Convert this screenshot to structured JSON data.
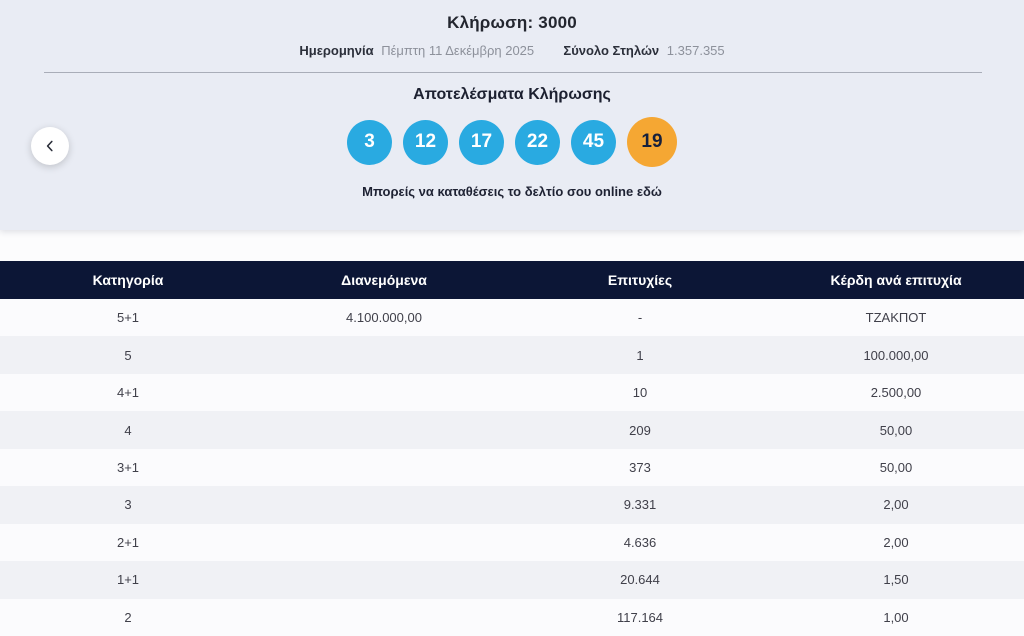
{
  "draw": {
    "title": "Κλήρωση: 3000",
    "date_label": "Ημερομηνία",
    "date_value": "Πέμπτη 11 Δεκέμβρη 2025",
    "columns_label": "Σύνολο Στηλών",
    "columns_value": "1.357.355"
  },
  "results": {
    "title": "Αποτελέσματα Κλήρωσης",
    "numbers": [
      "3",
      "12",
      "17",
      "22",
      "45"
    ],
    "joker_number": "19",
    "cta": "Μπορείς να καταθέσεις το δελτίο σου online εδώ"
  },
  "table": {
    "headers": [
      "Κατηγορία",
      "Διανεμόμενα",
      "Επιτυχίες",
      "Κέρδη ανά επιτυχία"
    ],
    "rows": [
      [
        "5+1",
        "4.100.000,00",
        "-",
        "ΤΖΑΚΠΟΤ"
      ],
      [
        "5",
        "",
        "1",
        "100.000,00"
      ],
      [
        "4+1",
        "",
        "10",
        "2.500,00"
      ],
      [
        "4",
        "",
        "209",
        "50,00"
      ],
      [
        "3+1",
        "",
        "373",
        "50,00"
      ],
      [
        "3",
        "",
        "9.331",
        "2,00"
      ],
      [
        "2+1",
        "",
        "4.636",
        "2,00"
      ],
      [
        "1+1",
        "",
        "20.644",
        "1,50"
      ],
      [
        "2",
        "",
        "117.164",
        "1,00"
      ]
    ]
  },
  "colors": {
    "ball_blue": "#29aae1",
    "ball_orange": "#f5a733",
    "table_header_navy": "#0c1636",
    "hero_background": "#e9ecf4"
  }
}
